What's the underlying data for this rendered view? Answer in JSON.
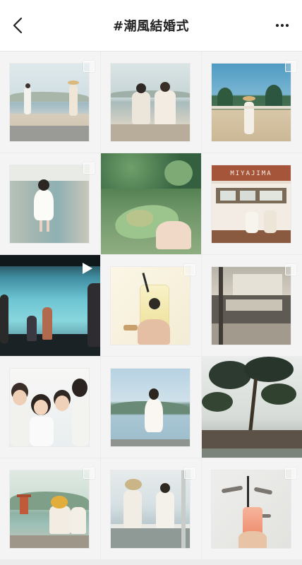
{
  "header": {
    "title": "#潮風結婚式",
    "back_icon": "chevron-left-icon",
    "more_icon": "more-horizontal-icon"
  },
  "photos": [
    {
      "subject": "beach-couple-walking",
      "has_checkbox": true
    },
    {
      "subject": "couple-sitting-on-seawall",
      "has_checkbox": true
    },
    {
      "subject": "woman-at-shrine-grounds",
      "has_checkbox": true
    },
    {
      "subject": "child-by-stream",
      "has_checkbox": true
    },
    {
      "subject": "matcha-dessert-in-garden",
      "has_checkbox": false
    },
    {
      "subject": "miyajima-shop-front",
      "has_checkbox": false,
      "sign_text": "MIYAJIMA"
    },
    {
      "subject": "aquarium-tank-video",
      "has_checkbox": false,
      "is_video": true
    },
    {
      "subject": "hand-holding-lemon-drink",
      "has_checkbox": true
    },
    {
      "subject": "shop-window-reflection",
      "has_checkbox": true
    },
    {
      "subject": "group-selfie",
      "has_checkbox": false
    },
    {
      "subject": "child-at-seaside",
      "has_checkbox": false
    },
    {
      "subject": "pine-trees-old-house",
      "has_checkbox": false
    },
    {
      "subject": "mother-child-torii-view",
      "has_checkbox": true
    },
    {
      "subject": "couple-on-balcony",
      "has_checkbox": true
    },
    {
      "subject": "hand-holding-pink-drink",
      "has_checkbox": true
    }
  ]
}
